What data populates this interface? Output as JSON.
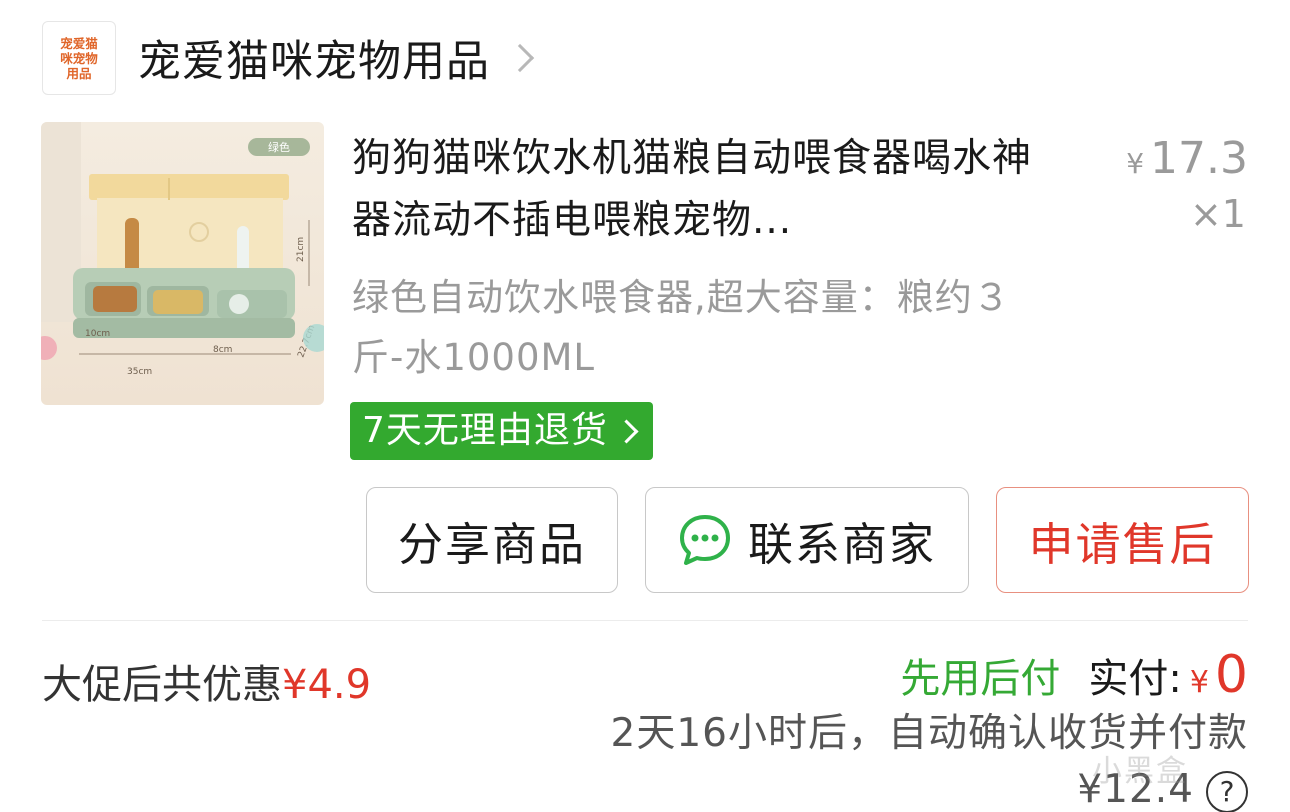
{
  "shop": {
    "logo_text": "宠爱猫咪宠物用品",
    "name": "宠爱猫咪宠物用品"
  },
  "product": {
    "title": "狗狗猫咪饮水机猫粮自动喂食器喝水神器流动不插电喂粮宠物...",
    "spec": "绿色自动饮水喂食器,超大容量：粮约３斤-水1000ML",
    "price_symbol": "¥",
    "price": "17.3",
    "quantity": "×1",
    "image": {
      "color_tag": "绿色",
      "dimensions": [
        "10cm",
        "8cm",
        "35cm",
        "21cm",
        "22.7cm"
      ]
    }
  },
  "return_policy": {
    "label": "7天无理由退货"
  },
  "actions": {
    "share": "分享商品",
    "contact": "联系商家",
    "aftersale": "申请售后"
  },
  "summary": {
    "promo_label": "大促后共优惠",
    "promo_amount": "¥4.9",
    "paylater": "先用后付",
    "paid_label": "实付:",
    "paid_symbol": "¥",
    "paid_amount": "0",
    "confirm_text": "2天16小时后，自动确认收货并付款¥12.4",
    "help_icon_glyph": "?"
  },
  "watermark": "小黑盒",
  "colors": {
    "accent_red": "#e0372a",
    "badge_green": "#33a92f",
    "paylater_green": "#35a935",
    "muted_gray": "#9a9a9a"
  }
}
